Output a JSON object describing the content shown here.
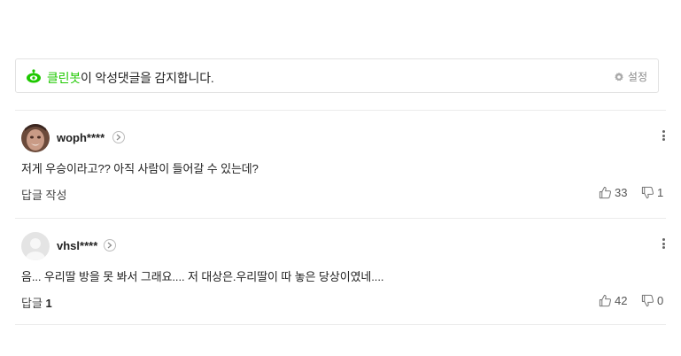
{
  "cleanbot": {
    "name": "클린봇",
    "message": "이 악성댓글을 감지합니다.",
    "settings_label": "설정"
  },
  "comments": [
    {
      "nickname": "woph****",
      "text": "저게 우승이라고?? 아직 사람이 들어갈 수 있는데?",
      "reply_label": "답글 작성",
      "reply_count": "",
      "likes": "33",
      "dislikes": "1",
      "avatar": "photo"
    },
    {
      "nickname": "vhsl****",
      "text": "음... 우리딸 방을 못 봐서 그래요.... 저 대상은.우리딸이 따 놓은 당상이였네....",
      "reply_label": "답글",
      "reply_count": "1",
      "likes": "42",
      "dislikes": "0",
      "avatar": "default"
    }
  ],
  "colors": {
    "cleanbot_green": "#1ec800",
    "border": "#e2e2e2"
  }
}
